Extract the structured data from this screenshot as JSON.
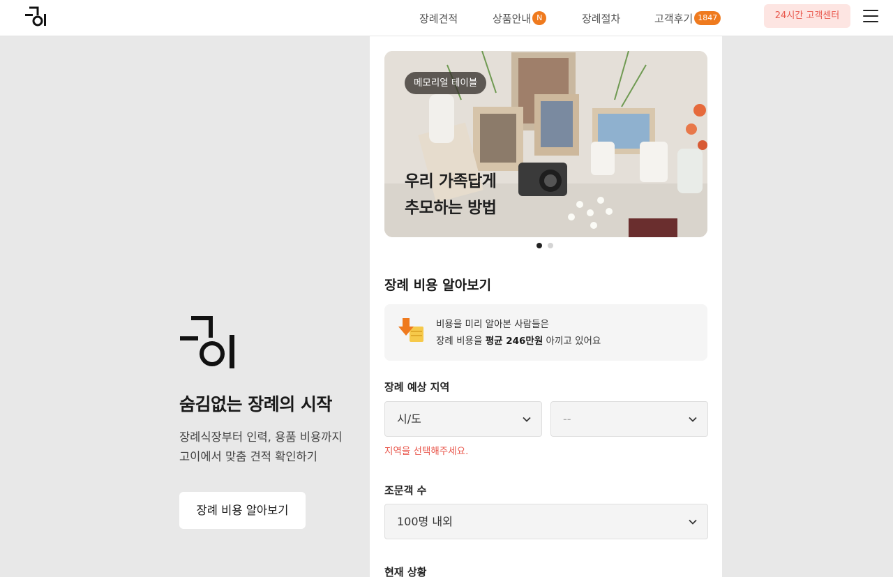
{
  "header": {
    "nav": [
      {
        "label": "장례견적"
      },
      {
        "label": "상품안내",
        "badge": "N"
      },
      {
        "label": "장례절차"
      },
      {
        "label": "고객후기",
        "badge": "1847"
      }
    ],
    "cs_label": "24시간 고객센터"
  },
  "hero": {
    "title": "숨김없는 장례의 시작",
    "sub_line1": "장례식장부터 인력, 용품 비용까지",
    "sub_line2": "고이에서 맞춤 견적 확인하기",
    "cta": "장례 비용 알아보기"
  },
  "banner": {
    "tag": "메모리얼 테이블",
    "line1": "우리 가족답게",
    "line2": "추모하는 방법",
    "slides": 2,
    "active_slide": 1
  },
  "estimate": {
    "title": "장례 비용 알아보기",
    "info_line1": "비용을 미리 알아본 사람들은",
    "info_pre": "장례 비용을 ",
    "info_bold": "평균 246만원",
    "info_post": " 아끼고 있어요",
    "region_label": "장례 예상 지역",
    "region_value": "시/도",
    "district_value": "--",
    "region_error": "지역을 선택해주세요.",
    "guests_label": "조문객 수",
    "guests_value": "100명 내외",
    "status_label": "현재 상황"
  },
  "colors": {
    "accent": "#ef7a1e",
    "cs_bg": "#fde5e2",
    "error": "#e9584d"
  }
}
